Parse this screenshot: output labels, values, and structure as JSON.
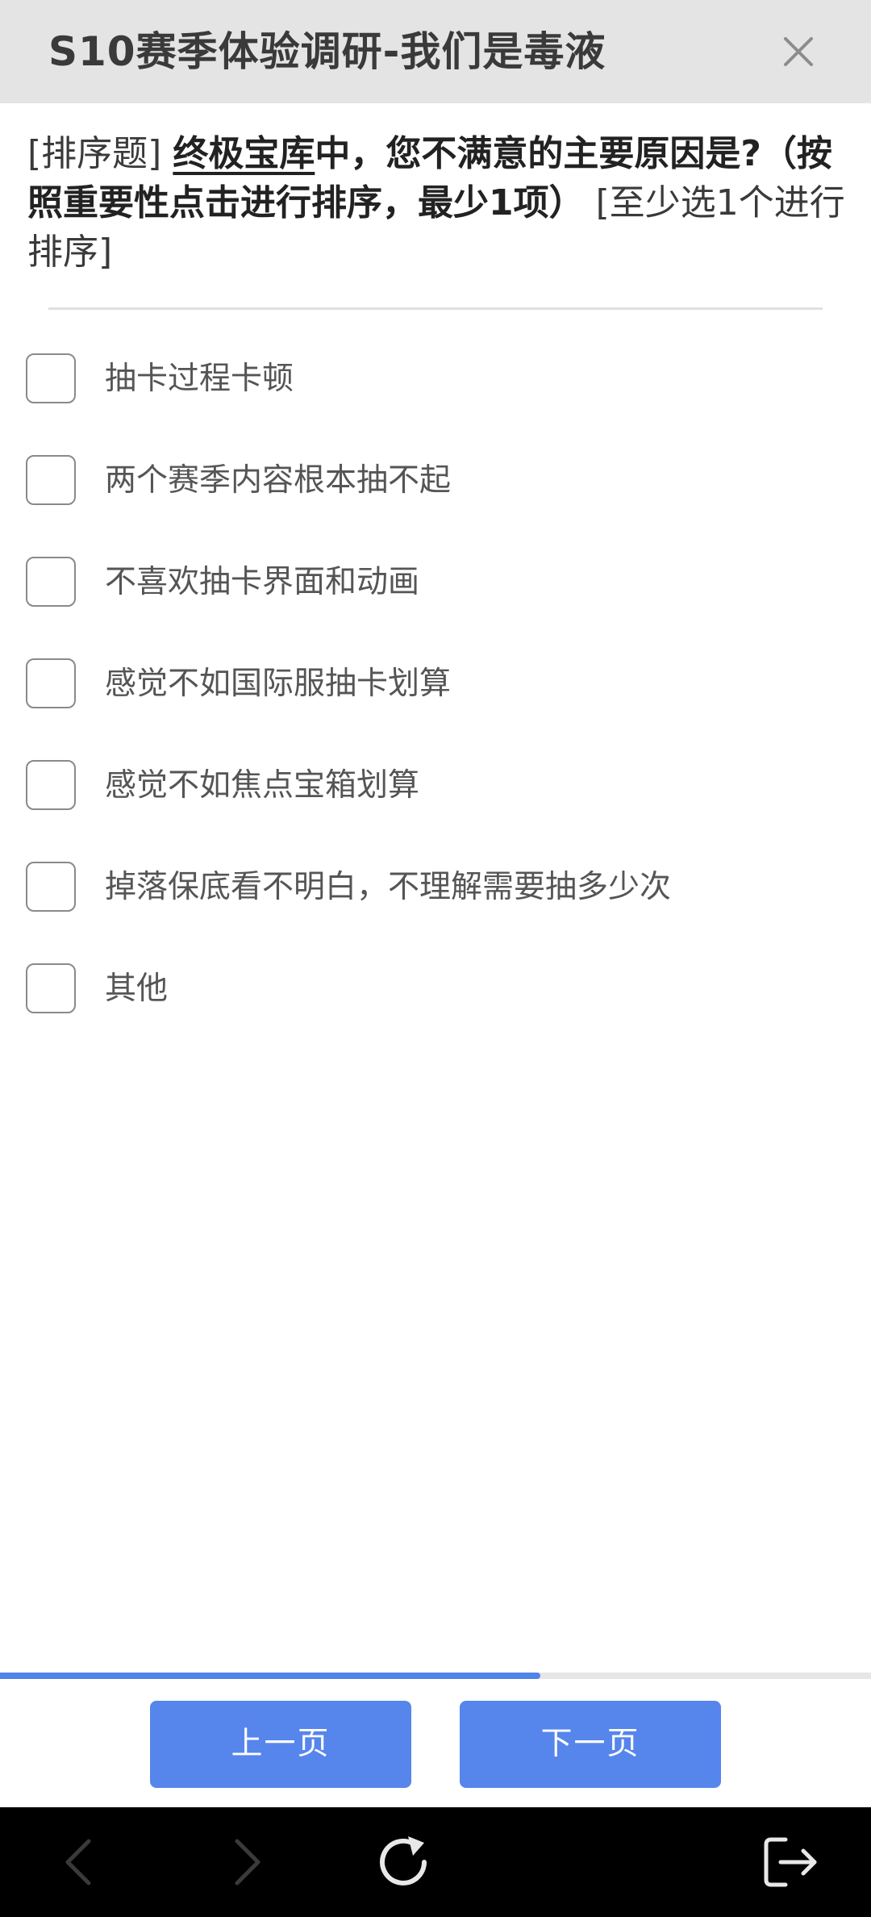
{
  "header": {
    "title": "S10赛季体验调研-我们是毒液"
  },
  "question": {
    "type_tag": "[排序题]",
    "keyword": "终极宝库",
    "text": "中，您不满意的主要原因是?（按照重要性点击进行排序，最少1项）",
    "requirement": "[至少选1个进行排序]"
  },
  "options": [
    {
      "label": "抽卡过程卡顿",
      "checked": false
    },
    {
      "label": "两个赛季内容根本抽不起",
      "checked": false
    },
    {
      "label": "不喜欢抽卡界面和动画",
      "checked": false
    },
    {
      "label": "感觉不如国际服抽卡划算",
      "checked": false
    },
    {
      "label": "感觉不如焦点宝箱划算",
      "checked": false
    },
    {
      "label": "掉落保底看不明白，不理解需要抽多少次",
      "checked": false
    },
    {
      "label": "其他",
      "checked": false
    }
  ],
  "progress": {
    "fraction": 0.62
  },
  "footer": {
    "prev_label": "上一页",
    "next_label": "下一页"
  },
  "colors": {
    "accent": "#5685ec",
    "header_bg": "#e4e4e4",
    "system_bar": "#000000"
  },
  "system_bar_icons": [
    "back-icon",
    "forward-icon",
    "refresh-icon",
    "exit-icon"
  ]
}
